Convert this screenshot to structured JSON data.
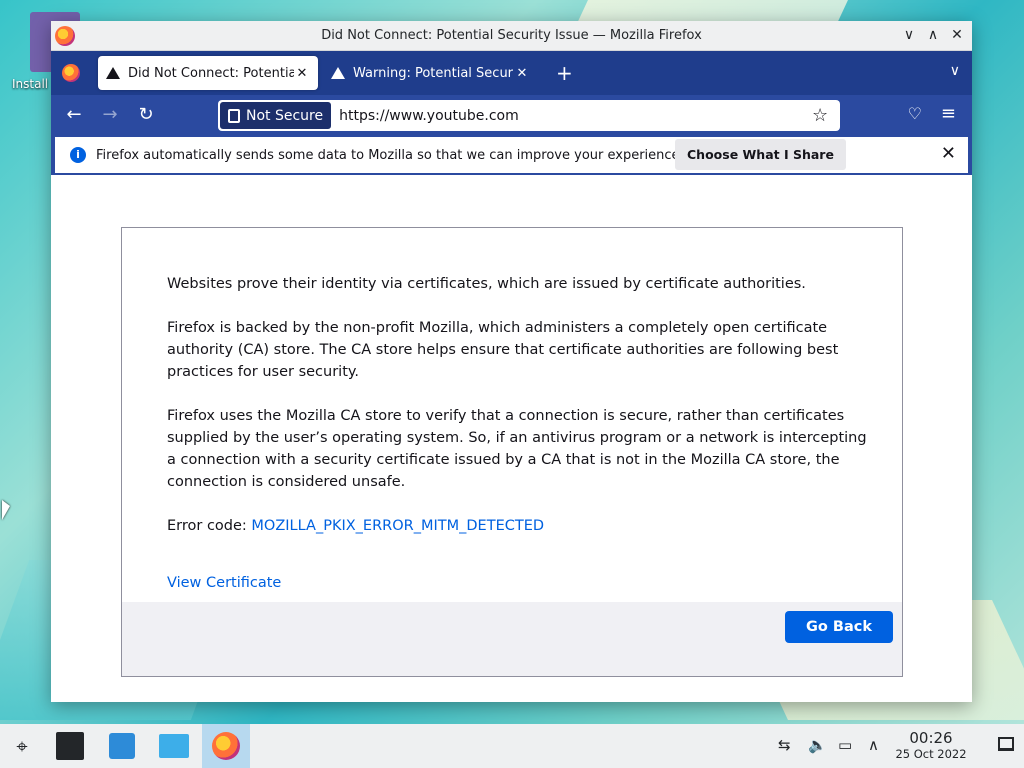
{
  "desktop": {
    "icon_label": "Install"
  },
  "window": {
    "title": "Did Not Connect: Potential Security Issue — Mozilla Firefox",
    "controls": {
      "minimize": "∨",
      "maximize": "∧",
      "close": "✕"
    }
  },
  "tabs": [
    {
      "title": "Did Not Connect: Potential",
      "close": "✕"
    },
    {
      "title": "Warning: Potential Security",
      "close": "✕"
    }
  ],
  "tabbar": {
    "new_tab": "+",
    "list_tabs": "∨"
  },
  "navbar": {
    "back": "←",
    "forward": "→",
    "reload": "↻",
    "security_label": "Not Secure",
    "url": "https://www.youtube.com",
    "bookmark_star": "☆",
    "pocket": "♡",
    "menu": "≡"
  },
  "notification": {
    "info": "i",
    "text": "Firefox automatically sends some data to Mozilla so that we can improve your experience.",
    "button": "Choose What I Share",
    "close": "✕"
  },
  "error_page": {
    "para1": "Websites prove their identity via certificates, which are issued by certificate authorities.",
    "para2": "Firefox is backed by the non-profit Mozilla, which administers a completely open certificate authority (CA) store. The CA store helps ensure that certificate authorities are following best practices for user security.",
    "para3": "Firefox uses the Mozilla CA store to verify that a connection is secure, rather than certificates supplied by the user’s operating system. So, if an antivirus program or a network is intercepting a connection with a security certificate issued by a CA that is not in the Mozilla CA store, the connection is considered unsafe.",
    "error_label": "Error code: ",
    "error_code": "MOZILLA_PKIX_ERROR_MITM_DETECTED",
    "view_certificate": "View Certificate",
    "go_back": "Go Back"
  },
  "taskbar": {
    "launcher": "⌖",
    "tray": {
      "network_icon": "⇆",
      "volume": "🔈",
      "display": "▭",
      "expand": "∧"
    },
    "clock": {
      "time": "00:26",
      "date": "25 Oct 2022"
    }
  },
  "colors": {
    "accent": "#0061e0",
    "tabbar": "#1f3d8c",
    "navbar": "#2b4aa0"
  }
}
